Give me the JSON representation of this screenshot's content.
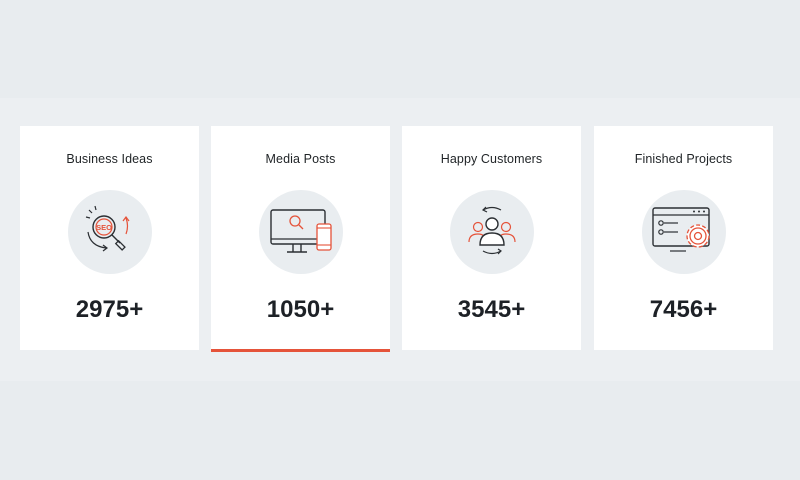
{
  "colors": {
    "accent": "#e5533a",
    "icon_stroke": "#2b2f33",
    "card_bg": "#ffffff",
    "icon_bg": "#e9edf0",
    "page_bg": "#e8ecef"
  },
  "stats": [
    {
      "title": "Business Ideas",
      "value": "2975+",
      "icon": "seo-magnifier-icon"
    },
    {
      "title": "Media Posts",
      "value": "1050+",
      "icon": "monitor-phone-search-icon",
      "active": true
    },
    {
      "title": "Happy Customers",
      "value": "3545+",
      "icon": "customers-cycle-icon"
    },
    {
      "title": "Finished Projects",
      "value": "7456+",
      "icon": "browser-gear-icon"
    }
  ],
  "seo_text": "SEO"
}
